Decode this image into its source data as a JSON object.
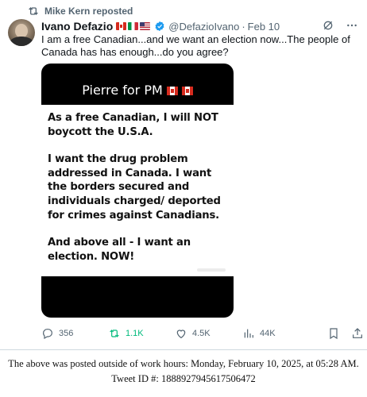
{
  "repost_banner": {
    "text": "Mike Kern reposted",
    "icon": "repost-icon"
  },
  "author": {
    "name": "Ivano Defazio",
    "flags": [
      "canada-flag",
      "italy-flag",
      "usa-flag"
    ],
    "verified_icon": "verified-badge-icon",
    "handle": "@DefazioIvano",
    "separator": "·",
    "timestamp": "Feb 10"
  },
  "header_icons": [
    "grok-icon",
    "more-icon"
  ],
  "tweet": {
    "text": "I am a free Canadian...and we want an election now...The people of Canada has has enough...do you agree?"
  },
  "media": {
    "title": "Pierre for PM",
    "paragraphs": [
      "As a free Canadian, I will NOT boycott the U.S.A.",
      "I want the drug problem addressed in Canada. I want the borders secured and individuals charged/ deported for crimes against Canadians.",
      "And above all - I want an election. NOW!"
    ]
  },
  "actions": {
    "replies": "356",
    "reposts": "1.1K",
    "likes": "4.5K",
    "views": "44K",
    "accent_repost": "#00ba7c"
  },
  "footer": {
    "line1": "The above was posted outside of work hours: Monday, February 10, 2025, at 05:28 AM.",
    "line2": "Tweet ID #: 1888927945617506472"
  }
}
